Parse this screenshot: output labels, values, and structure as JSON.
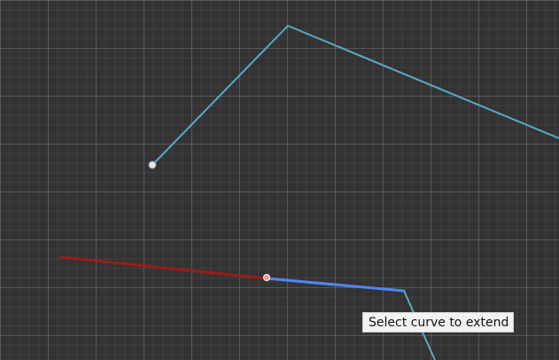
{
  "tooltip": {
    "text": "Select curve to extend"
  },
  "colors": {
    "canvas_background": "#333333",
    "existing_curve": "#5aa8c8",
    "extension_preview": "#9b1c1c",
    "highlighted_curve": "#4f86f7",
    "endpoint_marker": "#e8e8e8",
    "snap_point": "#ff9a9a"
  }
}
